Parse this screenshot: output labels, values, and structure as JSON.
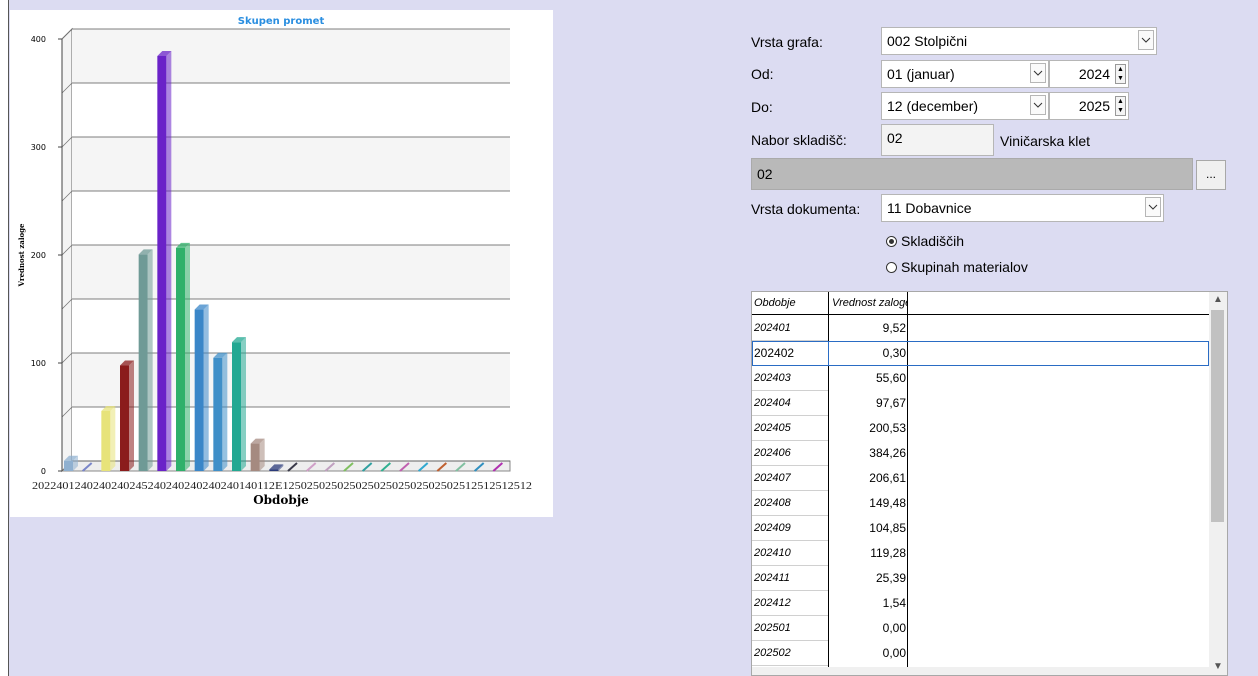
{
  "chart_data": {
    "type": "bar",
    "title": "Skupen promet",
    "xlabel": "Obdobje",
    "ylabel": "Vrednost zaloge",
    "categories": [
      "202401",
      "202402",
      "202403",
      "202404",
      "202405",
      "202406",
      "202407",
      "202408",
      "202409",
      "202410",
      "202411",
      "202412",
      "202501",
      "202502",
      "202503",
      "202504",
      "202505",
      "202506",
      "202507",
      "202508",
      "202509",
      "202510",
      "202511",
      "202512"
    ],
    "values": [
      9.52,
      0.3,
      55.6,
      97.67,
      200.53,
      384.26,
      206.61,
      149.48,
      104.85,
      119.28,
      25.39,
      1.54,
      0.0,
      0.0,
      0.0,
      0.0,
      0.0,
      0.0,
      0.0,
      0.0,
      0.0,
      0.0,
      0.0,
      0.0
    ],
    "colors": [
      "#8fb0d0",
      "#7a86c9",
      "#e7e37a",
      "#8b1c1c",
      "#6f9a96",
      "#6a22c8",
      "#2fb06a",
      "#3a86c8",
      "#3f8fc8",
      "#22a892",
      "#a58a80",
      "#2a3a7a",
      "#3a3a4a",
      "#d0a0c8",
      "#c0a0c0",
      "#80c060",
      "#30a0a0",
      "#30b090",
      "#c060b0",
      "#30a8d0",
      "#c06030",
      "#80c0a0",
      "#3090c0",
      "#b030b0"
    ],
    "ylim": [
      0,
      400
    ],
    "yticks": [
      0,
      100,
      200,
      300,
      400
    ],
    "x_tick_labels": "2022401240240240245240240240240240140112E12502502502502502502502502502512512512512",
    "grid": true,
    "legend": "none"
  },
  "form": {
    "vrsta_grafa_label": "Vrsta grafa:",
    "vrsta_grafa_value": "002 Stolpični",
    "od_label": "Od:",
    "od_month": "01 (januar)",
    "od_year": "2024",
    "do_label": "Do:",
    "do_month": "12 (december)",
    "do_year": "2025",
    "nabor_label": "Nabor skladišč:",
    "nabor_code": "02",
    "nabor_name": "Viničarska klet",
    "selected_list": "02",
    "dots_label": "...",
    "vrsta_dok_label": "Vrsta dokumenta:",
    "vrsta_dok_value": "11 Dobavnice",
    "radio_1": "Skladiščih",
    "radio_2": "Skupinah materialov"
  },
  "table": {
    "col1": "Obdobje",
    "col2": "Vrednost zaloge",
    "rows": [
      {
        "period": "202401",
        "value": "9,52"
      },
      {
        "period": "202402",
        "value": "0,30"
      },
      {
        "period": "202403",
        "value": "55,60"
      },
      {
        "period": "202404",
        "value": "97,67"
      },
      {
        "period": "202405",
        "value": "200,53"
      },
      {
        "period": "202406",
        "value": "384,26"
      },
      {
        "period": "202407",
        "value": "206,61"
      },
      {
        "period": "202408",
        "value": "149,48"
      },
      {
        "period": "202409",
        "value": "104,85"
      },
      {
        "period": "202410",
        "value": "119,28"
      },
      {
        "period": "202411",
        "value": "25,39"
      },
      {
        "period": "202412",
        "value": "1,54"
      },
      {
        "period": "202501",
        "value": "0,00"
      },
      {
        "period": "202502",
        "value": "0,00"
      }
    ]
  }
}
